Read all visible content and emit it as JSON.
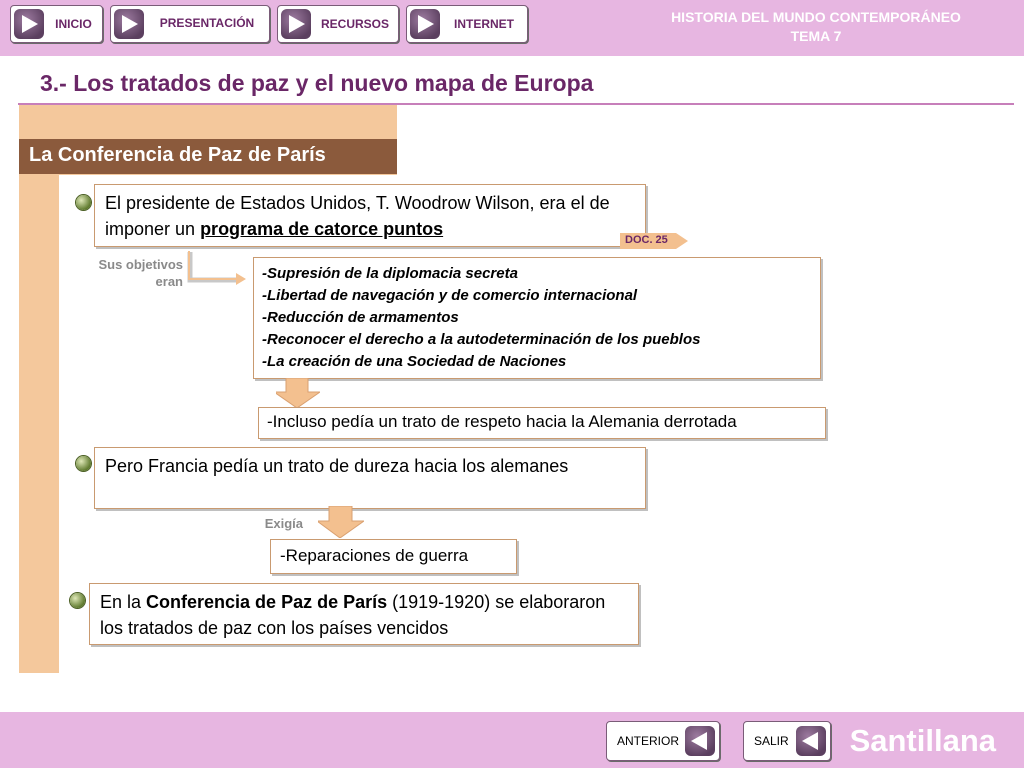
{
  "nav": {
    "buttons": [
      {
        "label": "INICIO",
        "icon": "play-icon"
      },
      {
        "label": "PRESENTACIÓN",
        "icon": "play-icon"
      },
      {
        "label": "RECURSOS",
        "icon": "play-icon"
      },
      {
        "label": "INTERNET",
        "icon": "play-icon"
      }
    ]
  },
  "header": {
    "line1": "HISTORIA DEL MUNDO CONTEMPORÁNEO",
    "line2": "TEMA 7"
  },
  "page_title": "3.- Los tratados de paz y el nuevo mapa de Europa",
  "section_title": "La Conferencia de Paz de París",
  "block1": {
    "text_pre": "El presidente de Estados Unidos, T. Woodrow Wilson, era el de imponer un ",
    "link": "programa de catorce puntos",
    "doc_tag": "DOC. 25",
    "label_line1": "Sus objetivos",
    "label_line2": "eran",
    "objectives": [
      "-Supresión de la diplomacia secreta",
      "-Libertad de navegación y de comercio internacional",
      "-Reducción de armamentos",
      "-Reconocer el derecho a la autodeterminación de los pueblos",
      "-La creación de una Sociedad de Naciones"
    ],
    "note": "-Incluso pedía un trato de respeto hacia la Alemania derrotada"
  },
  "block2": {
    "text": "Pero Francia pedía un trato de dureza hacia los alemanes",
    "label": "Exigía",
    "demand": "-Reparaciones de guerra"
  },
  "block3": {
    "text_pre": "En la ",
    "text_bold": "Conferencia de Paz de París",
    "text_post": " (1919-1920) se elaboraron los tratados de paz con los países vencidos"
  },
  "footer": {
    "prev_label": "ANTERIOR",
    "exit_label": "SALIR",
    "brand": "Santillana"
  },
  "colors": {
    "bar": "#e7b6e1",
    "title": "#6a2767",
    "section": "#8b5a3c",
    "beige": "#f4c89c",
    "accent_arrow": "#f3c08f"
  }
}
